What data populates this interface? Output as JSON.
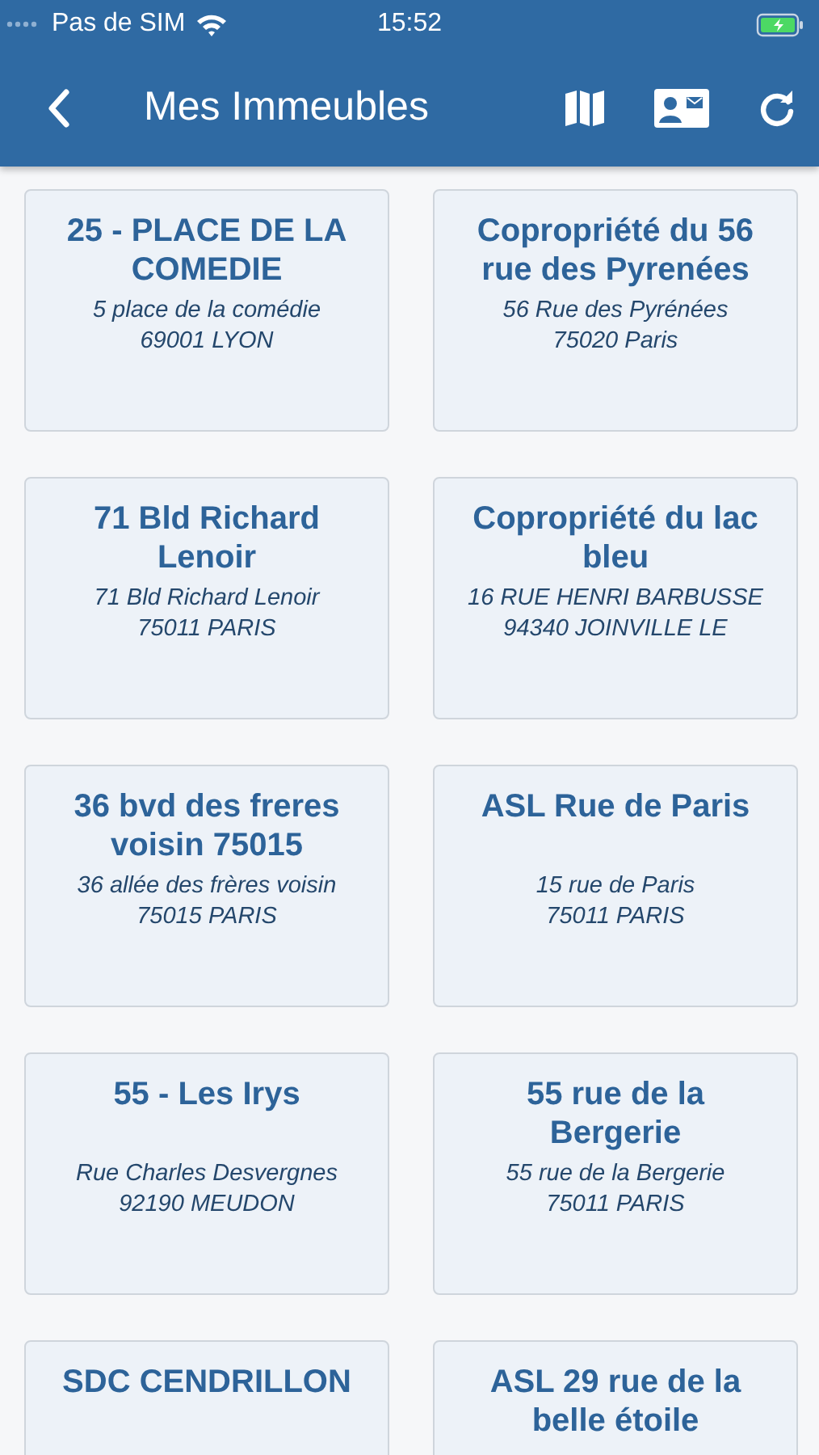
{
  "status_bar": {
    "carrier": "Pas de SIM",
    "time": "15:52"
  },
  "header": {
    "title": "Mes Immeubles"
  },
  "buildings": [
    {
      "title": "25 - PLACE DE LA COMEDIE",
      "address": [
        "5 place de la comédie",
        "69001 LYON"
      ]
    },
    {
      "title": "Copropriété du 56 rue des Pyrenées",
      "address": [
        "56 Rue des Pyrénées",
        "75020 Paris"
      ]
    },
    {
      "title": "71 Bld Richard Lenoir",
      "address": [
        "71 Bld Richard Lenoir",
        "75011 PARIS"
      ]
    },
    {
      "title": "Copropriété du lac bleu",
      "address": [
        "16 RUE HENRI BARBUSSE",
        "94340 JOINVILLE LE"
      ]
    },
    {
      "title": "36 bvd des freres voisin 75015",
      "address": [
        "36 allée des frères voisin",
        "75015 PARIS"
      ]
    },
    {
      "title": "ASL Rue de Paris",
      "address": [
        "15 rue de Paris",
        "75011 PARIS"
      ]
    },
    {
      "title": "55 - Les Irys",
      "address": [
        "Rue Charles Desvergnes",
        "92190 MEUDON"
      ]
    },
    {
      "title": "55 rue de la Bergerie",
      "address": [
        "55 rue de la Bergerie",
        "75011 PARIS"
      ]
    },
    {
      "title": "SDC CENDRILLON"
    },
    {
      "title": "ASL 29 rue de la belle étoile"
    }
  ]
}
